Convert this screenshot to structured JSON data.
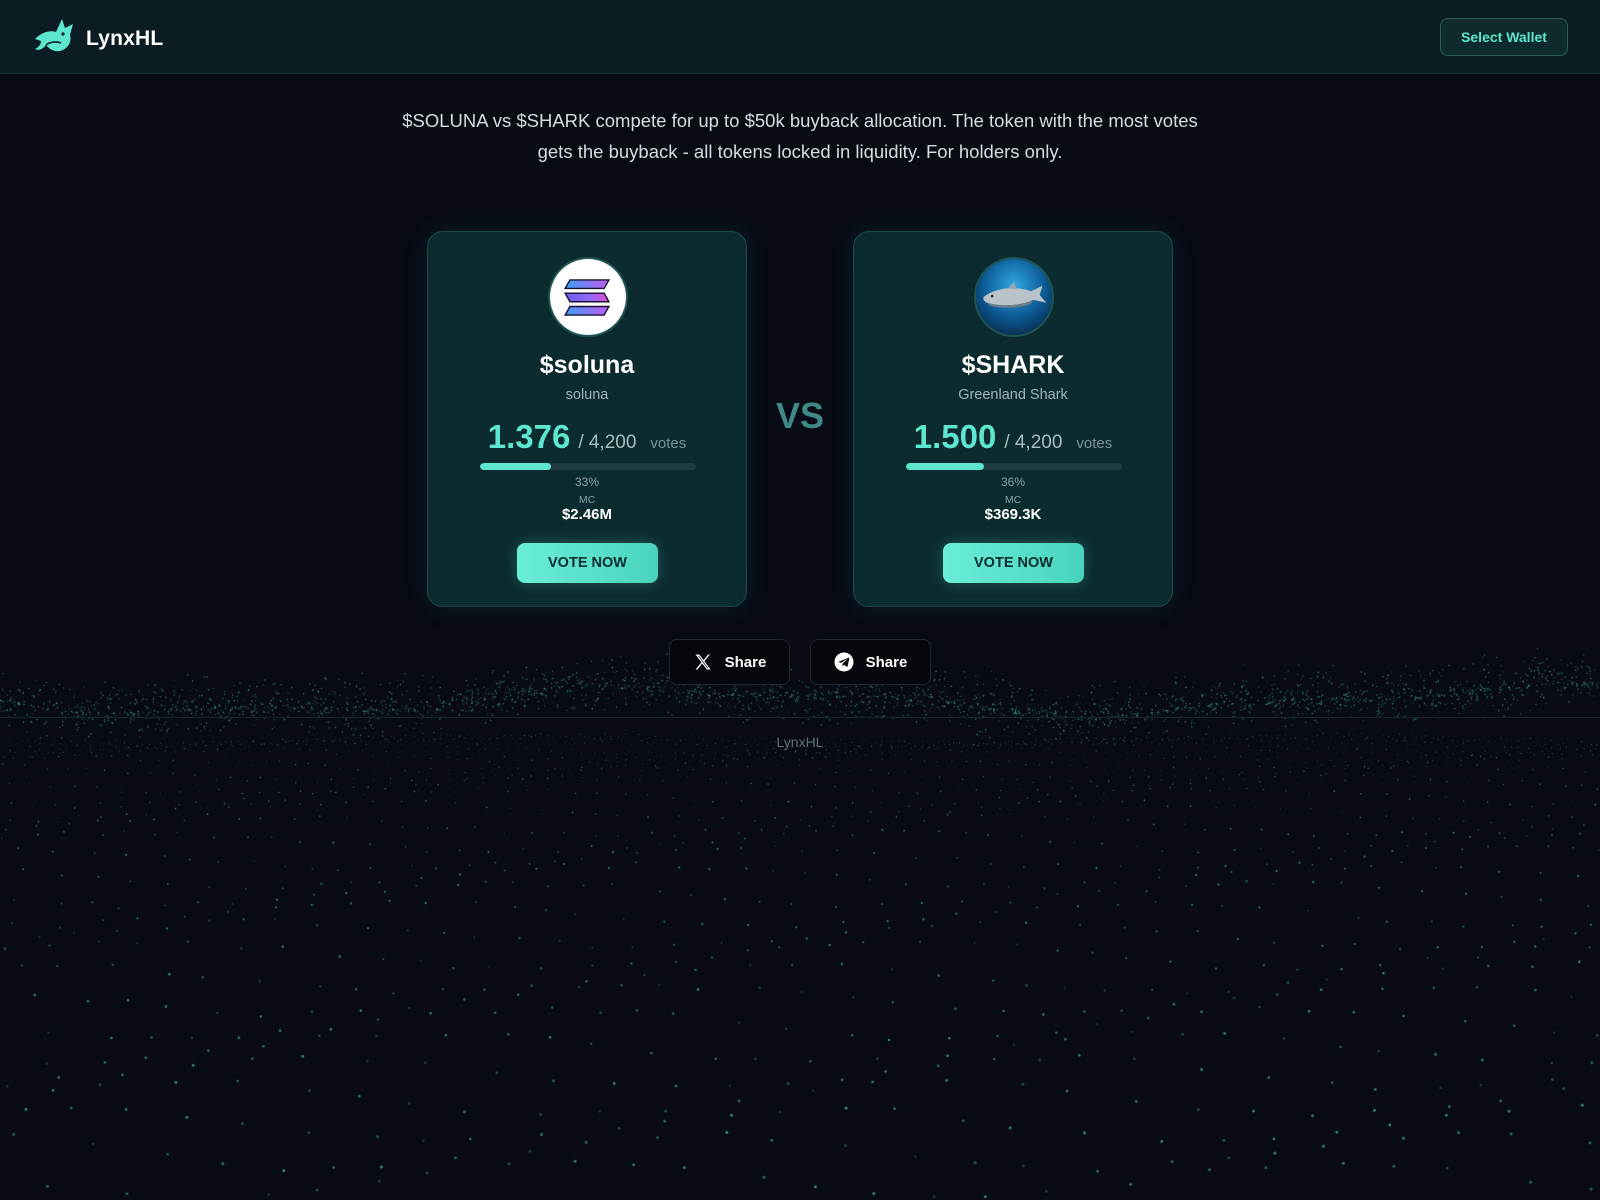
{
  "header": {
    "brand_name": "LynxHL",
    "logo_icon": "lynx-logo-icon",
    "wallet_button_label": "Select Wallet"
  },
  "intro": {
    "text": "$SOLUNA vs $SHARK compete for up to $50k buyback allocation. The token with the most votes gets the buyback - all tokens locked in liquidity. For holders only."
  },
  "cards": [
    {
      "symbol": "$soluna",
      "name": "soluna",
      "votes": "1.376",
      "votes_total": "/ 4,200",
      "votes_label": "votes",
      "progress": 0.33,
      "percent_label": "33%",
      "mc_label": "MC",
      "mc_value": "$2.46M",
      "vote_button_label": "VOTE NOW",
      "logo_icon": "soluna-logo-icon"
    },
    {
      "symbol": "$SHARK",
      "name": "Greenland Shark",
      "votes": "1.500",
      "votes_total": "/ 4,200",
      "votes_label": "votes",
      "progress": 0.36,
      "percent_label": "36%",
      "mc_label": "MC",
      "mc_value": "$369.3K",
      "vote_button_label": "VOTE NOW",
      "logo_icon": "shark-logo-icon"
    }
  ],
  "vs_label": "VS",
  "share": {
    "x_label": "Share",
    "x_icon": "x-icon",
    "telegram_label": "Share",
    "telegram_icon": "telegram-icon"
  },
  "footer": {
    "text": "LynxHL"
  },
  "colors": {
    "accent": "#5ee7cf",
    "background": "#080a14",
    "card": "#0b2b2e",
    "header": "#0b1c22"
  }
}
